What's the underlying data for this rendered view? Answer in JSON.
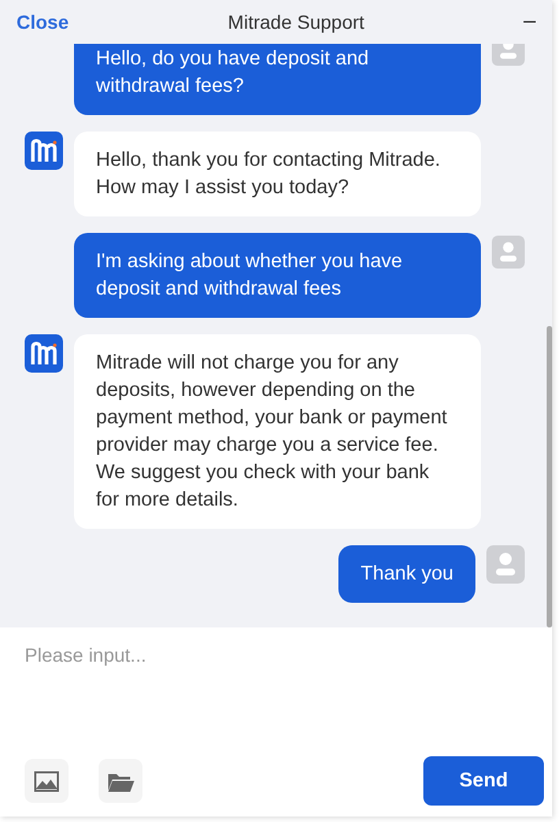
{
  "header": {
    "close": "Close",
    "title": "Mitrade Support",
    "minimize": "–"
  },
  "messages": [
    {
      "kind": "user",
      "text": "Hello, do you have deposit and withdrawal fees?"
    },
    {
      "kind": "agent",
      "text": "Hello, thank you for contacting Mitrade. How may I assist you today?"
    },
    {
      "kind": "user",
      "text": "I'm asking about whether you have deposit and withdrawal fees"
    },
    {
      "kind": "agent",
      "text": "Mitrade will not charge you for any deposits, however depending on the payment method, your bank or payment provider may charge you a service fee. We suggest you check with your bank for more details."
    },
    {
      "kind": "user",
      "text": "Thank you"
    }
  ],
  "composer": {
    "placeholder": "Please input...",
    "send": "Send"
  }
}
